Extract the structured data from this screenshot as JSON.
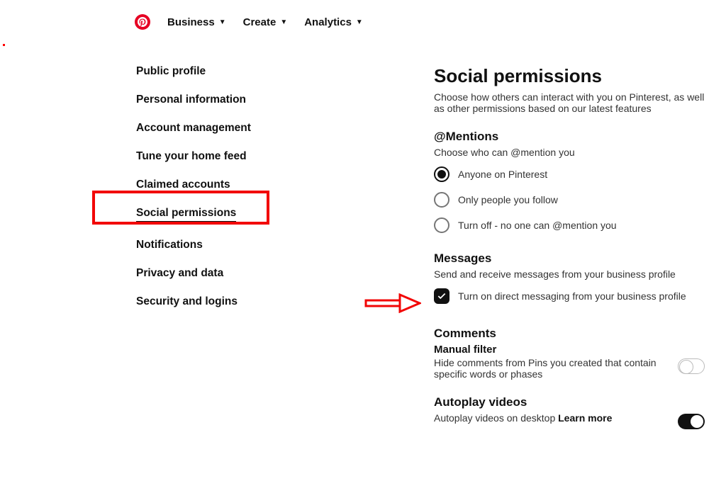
{
  "nav": {
    "items": [
      "Business",
      "Create",
      "Analytics"
    ]
  },
  "sidebar": {
    "items": [
      "Public profile",
      "Personal information",
      "Account management",
      "Tune your home feed",
      "Claimed accounts",
      "Social permissions",
      "Notifications",
      "Privacy and data",
      "Security and logins"
    ],
    "active_index": 5
  },
  "page": {
    "title": "Social permissions",
    "description": "Choose how others can interact with you on Pinterest, as well as other permissions based on our latest features"
  },
  "mentions": {
    "heading": "@Mentions",
    "sub": "Choose who can @mention you",
    "options": [
      "Anyone on Pinterest",
      "Only people you follow",
      "Turn off - no one can @mention you"
    ],
    "selected_index": 0
  },
  "messages": {
    "heading": "Messages",
    "sub": "Send and receive messages from your business profile",
    "checkbox_label": "Turn on direct messaging from your business profile",
    "checked": true
  },
  "comments": {
    "heading": "Comments",
    "manual_filter_label": "Manual filter",
    "manual_filter_desc": "Hide comments from Pins you created that contain specific words or phases",
    "manual_filter_on": false
  },
  "autoplay": {
    "heading": "Autoplay videos",
    "desc_prefix": "Autoplay videos on desktop ",
    "learn_more": "Learn more",
    "on": true
  }
}
